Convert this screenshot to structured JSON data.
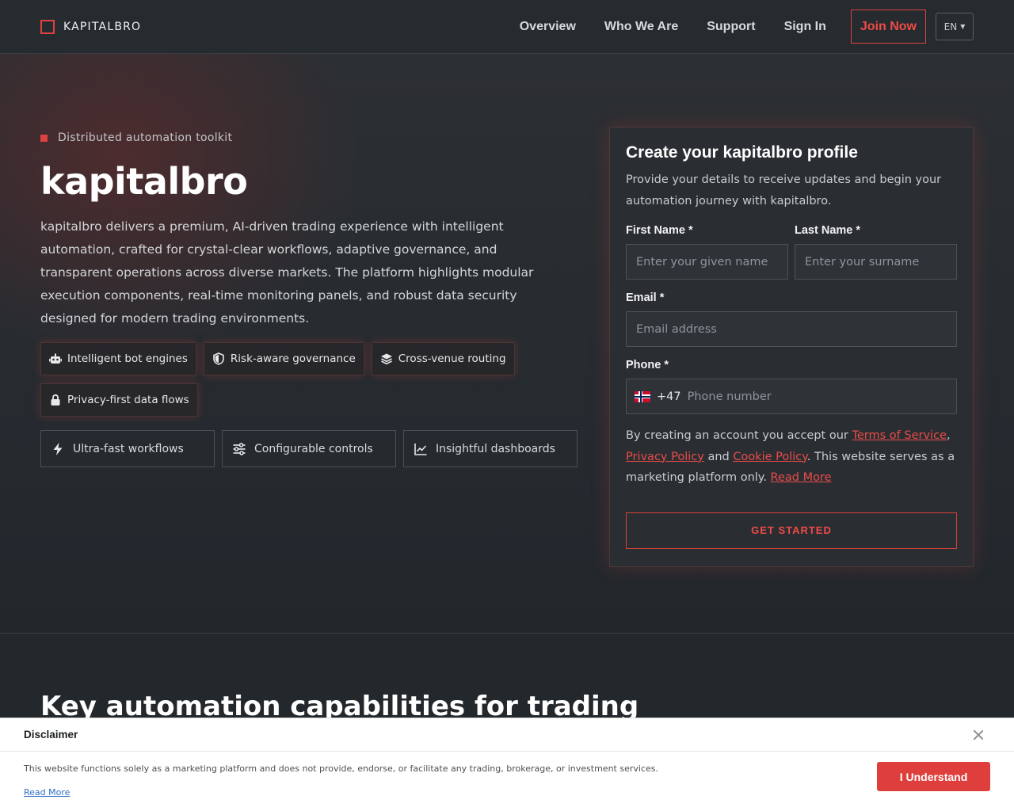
{
  "header": {
    "logo_text": "KAPITALBRO",
    "nav": [
      "Overview",
      "Who We Are",
      "Support",
      "Sign In"
    ],
    "join_label": "Join Now",
    "lang": "EN"
  },
  "hero": {
    "eyebrow": "Distributed automation toolkit",
    "title": "kapitalbro",
    "description": "kapitalbro delivers a premium, AI-driven trading experience with intelligent automation, crafted for crystal-clear workflows, adaptive governance, and transparent operations across diverse markets. The platform highlights modular execution components, real-time monitoring panels, and robust data security designed for modern trading environments.",
    "chips": [
      {
        "label": "Intelligent bot engines",
        "icon": "robot-icon"
      },
      {
        "label": "Risk-aware governance",
        "icon": "shield-icon"
      },
      {
        "label": "Cross-venue routing",
        "icon": "layers-icon"
      },
      {
        "label": "Privacy-first data flows",
        "icon": "lock-icon"
      }
    ],
    "features": [
      {
        "label": "Ultra-fast workflows",
        "icon": "bolt-icon"
      },
      {
        "label": "Configurable controls",
        "icon": "sliders-icon"
      },
      {
        "label": "Insightful dashboards",
        "icon": "chart-line-icon"
      }
    ]
  },
  "form": {
    "title": "Create your kapitalbro profile",
    "subtitle": "Provide your details to receive updates and begin your automation journey with kapitalbro.",
    "first_name_label": "First Name *",
    "first_name_placeholder": "Enter your given name",
    "last_name_label": "Last Name *",
    "last_name_placeholder": "Enter your surname",
    "email_label": "Email *",
    "email_placeholder": "Email address",
    "phone_label": "Phone *",
    "phone_code": "+47",
    "phone_placeholder": "Phone number",
    "terms_prefix": "By creating an account you accept our",
    "terms_link": "Terms of Service",
    "privacy_link": "Privacy Policy",
    "and_text": "and",
    "cookie_link": "Cookie Policy",
    "terms_suffix": ". This website serves as a marketing platform only.",
    "read_more": "Read More",
    "cta": "GET STARTED"
  },
  "section2": {
    "title": "Key automation capabilities for trading"
  },
  "disclaimer": {
    "title": "Disclaimer",
    "text": "This website functions solely as a marketing platform and does not provide, endorse, or facilitate any trading, brokerage, or investment services.",
    "read_more": "Read More",
    "button": "I Understand"
  },
  "colors": {
    "accent": "#e0423f",
    "background": "#23282d",
    "card": "#2a2e33"
  }
}
